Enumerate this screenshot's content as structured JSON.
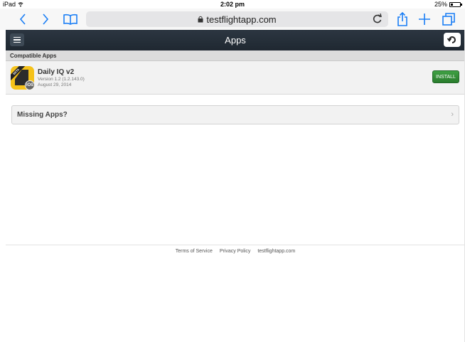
{
  "status_bar": {
    "device": "iPad",
    "time": "2:02 pm",
    "battery": "25%",
    "battery_level": 0.25
  },
  "browser": {
    "url": "testflightapp.com",
    "icons": [
      "back-icon",
      "forward-icon",
      "bookmarks-icon",
      "lock-icon",
      "reload-icon",
      "share-icon",
      "new-tab-icon",
      "tabs-icon"
    ]
  },
  "header": {
    "title": "Apps"
  },
  "section": {
    "title": "Compatible Apps"
  },
  "app": {
    "name": "Daily IQ v2",
    "version": "Version 1.2 (1.2.143.0)",
    "date": "August 29, 2014",
    "beta_badge": "BETA",
    "platform_badge": "iOS",
    "install_label": "INSTALL"
  },
  "missing": {
    "label": "Missing Apps?"
  },
  "footer": {
    "links": [
      "Terms of Service",
      "Privacy Policy",
      "testflightapp.com"
    ]
  },
  "colors": {
    "accent": "#1a7ef5",
    "header_bg": "#263039",
    "install_green": "#34913a",
    "icon_yellow": "#f5c21a"
  }
}
